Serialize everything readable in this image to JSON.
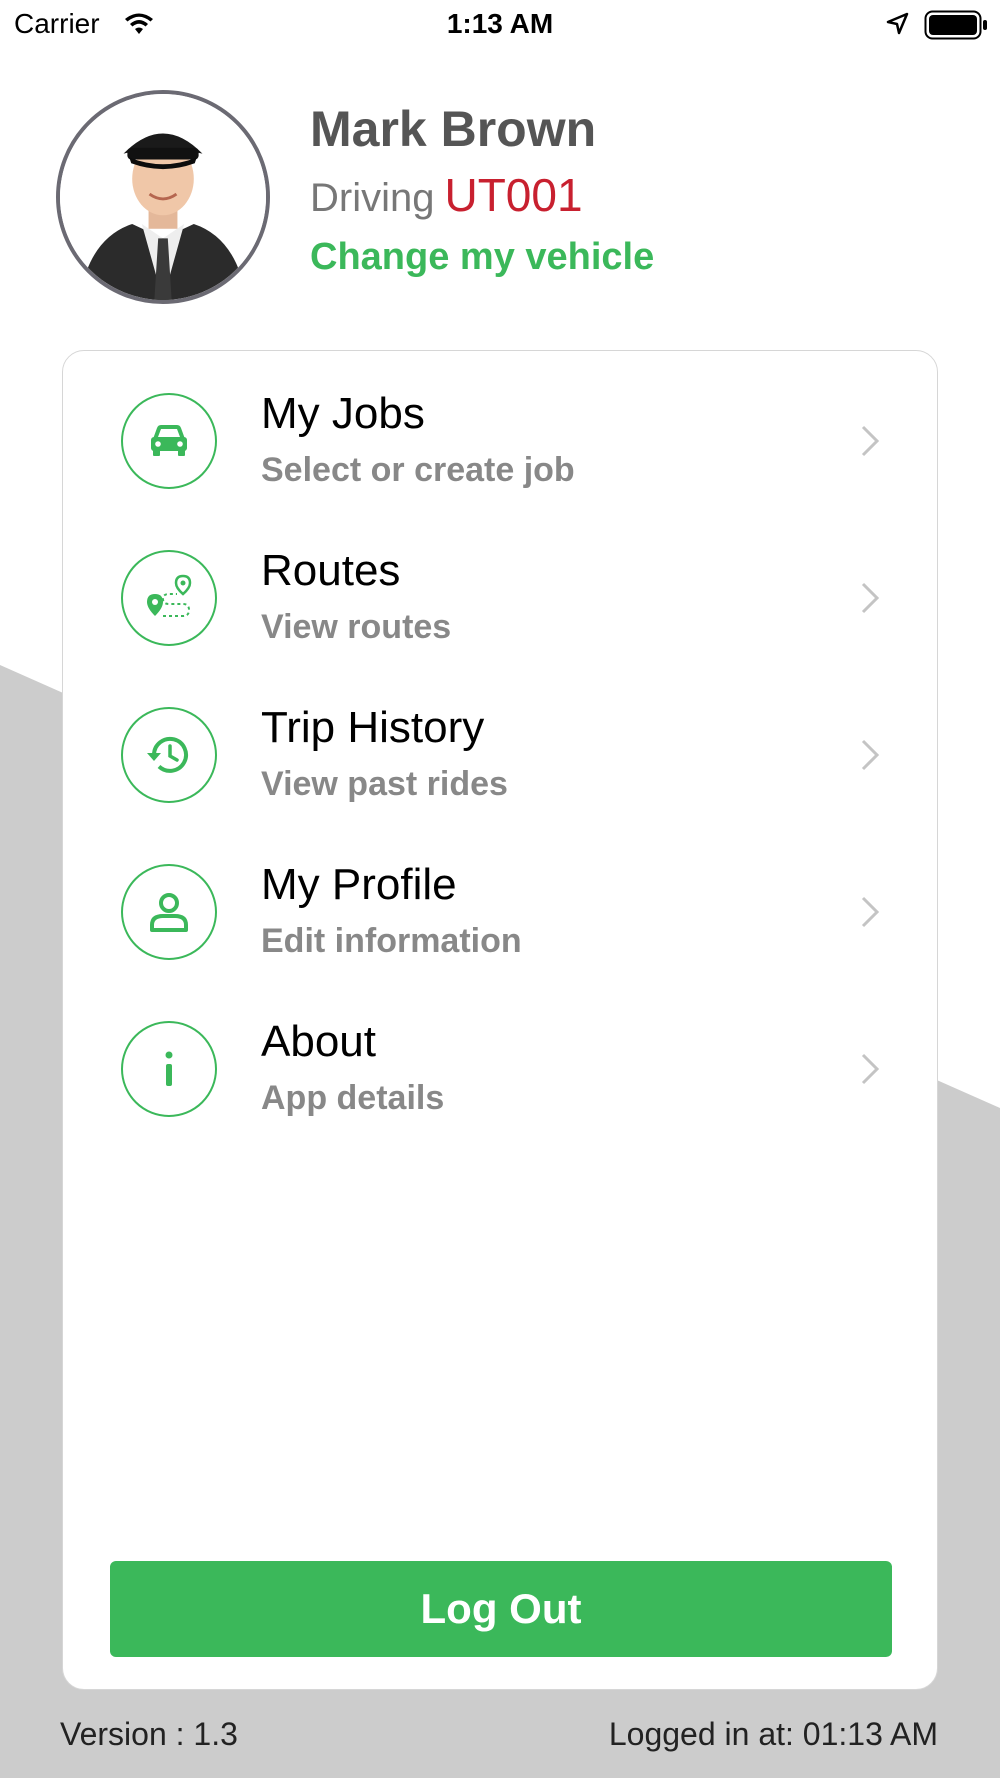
{
  "status_bar": {
    "carrier": "Carrier",
    "time": "1:13 AM",
    "icons": [
      "wifi-icon",
      "location-arrow-icon",
      "battery-icon"
    ]
  },
  "profile": {
    "name": "Mark Brown",
    "driving_label": "Driving",
    "vehicle_code": "UT001",
    "change_vehicle_label": "Change my vehicle",
    "avatar": "driver-avatar-photo"
  },
  "menu": {
    "items": [
      {
        "title": "My Jobs",
        "subtitle": "Select or create job",
        "icon": "car-icon"
      },
      {
        "title": "Routes",
        "subtitle": "View routes",
        "icon": "route-icon"
      },
      {
        "title": "Trip History",
        "subtitle": "View past rides",
        "icon": "history-icon"
      },
      {
        "title": "My Profile",
        "subtitle": "Edit information",
        "icon": "user-icon"
      },
      {
        "title": "About",
        "subtitle": "App details",
        "icon": "info-icon"
      }
    ]
  },
  "logout_label": "Log Out",
  "footer": {
    "version": "Version : 1.3",
    "logged_in": "Logged in at: 01:13 AM"
  },
  "colors": {
    "accent": "#3bb85a",
    "vehicle_code": "#c8202f",
    "background_shape": "#cccccc"
  }
}
